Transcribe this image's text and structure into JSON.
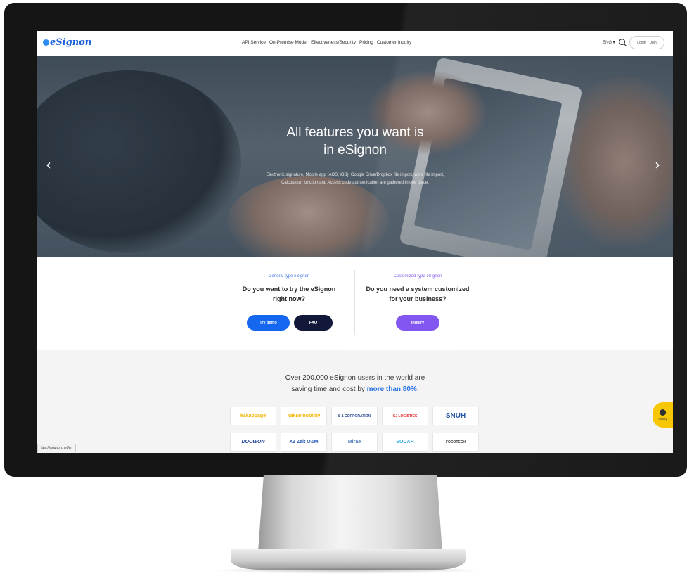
{
  "nav": {
    "logo": "eSignon",
    "menu": [
      "API Service",
      "On-Premise Model",
      "Effectiveness/Security",
      "Pricing",
      "Customer Inquiry"
    ],
    "lang": "ENG ▾",
    "login": "Login",
    "join": "Join"
  },
  "hero": {
    "title": [
      "All features you want is",
      "in eSignon"
    ],
    "subtitle": [
      "Electronic signature, Mobile app (AOS, iOS), Google Drive/Dropbox file import, word file import,",
      "Calculation function and Access code authentication are gathered in one place."
    ],
    "prev": "‹",
    "next": "›"
  },
  "cta": {
    "general": {
      "tag": "General-type eSignon",
      "question": [
        "Do you want to try the eSignon",
        "right now?"
      ],
      "demo": "Try demo",
      "faq": "FAQ"
    },
    "custom": {
      "tag": "Customized-type eSignon",
      "question": [
        "Do you need a system customized",
        "for your business?"
      ],
      "inquiry": "Inquiry"
    }
  },
  "clients": {
    "line1": "Over 200,000 eSignon users in the world are",
    "line2_prefix": "saving time and cost by ",
    "line2_highlight": "more than 80%",
    "line2_suffix": ".",
    "logos": [
      {
        "name": "kakaopage",
        "color": "#f3b400"
      },
      {
        "name": "kakaomobility",
        "color": "#f3b400"
      },
      {
        "name": "S-1 CORPORATION",
        "color": "#1a3d8f"
      },
      {
        "name": "CJ LOGISTICS",
        "color": "#e02020"
      },
      {
        "name": "SNUH",
        "color": "#1f4fa0"
      },
      {
        "name": "DOOWON",
        "color": "#1f3f9a"
      },
      {
        "name": "X3 Zeit O&M",
        "color": "#2b5fb8"
      },
      {
        "name": "Mirae",
        "color": "#3d6fb7"
      },
      {
        "name": "SOCAR",
        "color": "#28a8e0"
      },
      {
        "name": "FOODTECH",
        "color": "#333333"
      }
    ]
  },
  "status_url": "ttps://esignon.net/en",
  "inquiry_fab": "Inquiry",
  "colors": {
    "brand_blue": "#1667f0",
    "navy": "#11183a",
    "purple": "#7b4df0",
    "fab_yellow": "#f7c600"
  }
}
